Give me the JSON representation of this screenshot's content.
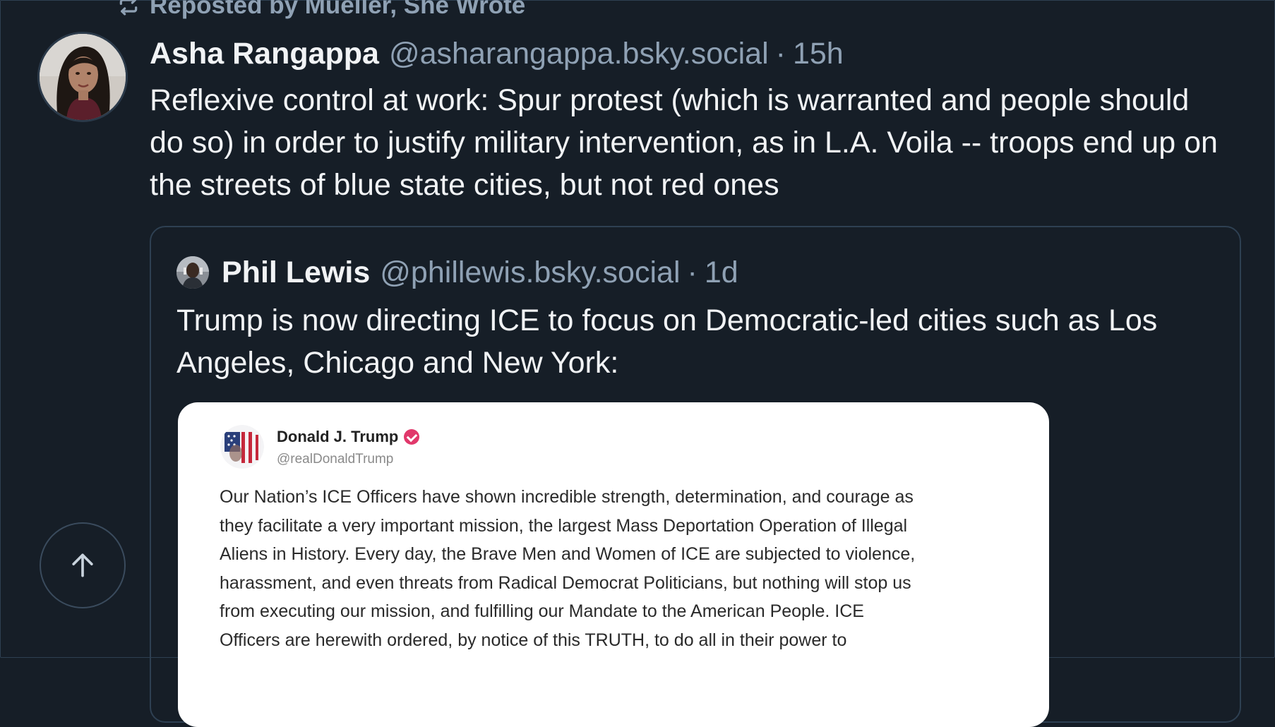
{
  "repost": {
    "icon": "repost-icon",
    "text": "Reposted by Mueller, She Wrote"
  },
  "post": {
    "avatar_icon": "avatar",
    "author": "Asha Rangappa",
    "handle": "@asharangappa.bsky.social",
    "separator": "·",
    "time": "15h",
    "text": "Reflexive control at work: Spur protest (which is warranted and people should do so) in order to justify military intervention, as in L.A. Voila -- troops end up on the streets of blue state cities, but not red ones"
  },
  "quote": {
    "author": "Phil Lewis",
    "handle": "@phillewis.bsky.social",
    "separator": "·",
    "time": "1d",
    "text": "Trump is now directing ICE to focus on Democratic-led cities such as Los Angeles, Chicago and New York:"
  },
  "embed": {
    "name": "Donald J. Trump",
    "handle": "@realDonaldTrump",
    "lines": [
      "Our Nation’s ICE Officers have shown incredible strength, determination, and courage as",
      "they facilitate a very important mission, the largest Mass Deportation Operation of Illegal",
      "Aliens in History. Every day, the Brave Men and Women of ICE are subjected to violence,",
      "harassment, and even threats from Radical Democrat Politicians, but nothing will stop us",
      "from executing our mission, and fulfilling our Mandate to the American People. ICE",
      "Officers are herewith ordered, by notice of this TRUTH, to do all in their power to"
    ]
  },
  "scroll_top": {
    "icon": "arrow-up-icon"
  },
  "colors": {
    "background": "#161e27",
    "border": "#2e4052",
    "muted_text": "#8fa1b4",
    "primary_text": "#f1f3f5",
    "verified_badge": "#e1386b"
  }
}
